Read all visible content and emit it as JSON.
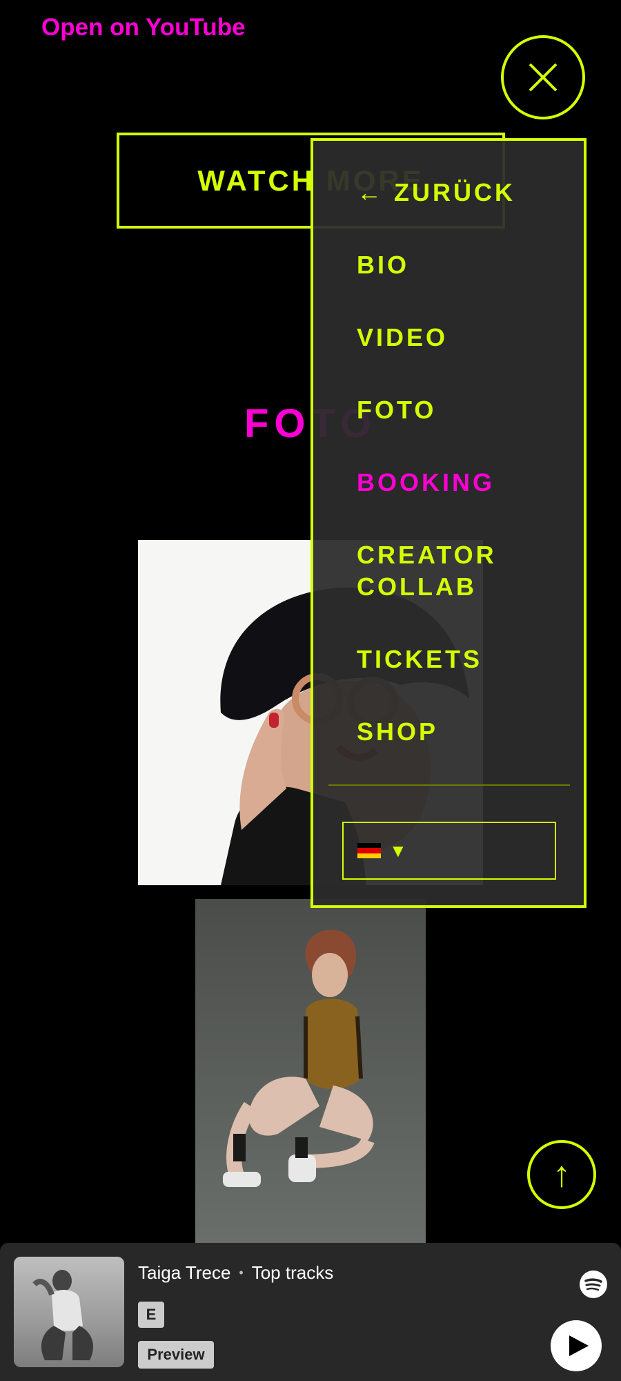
{
  "top": {
    "youtube_link": "Open on YouTube"
  },
  "watch_button": {
    "label": "WATCH MORE"
  },
  "section": {
    "title": "FOTO"
  },
  "menu": {
    "items": [
      {
        "label": "← ZURÜCK",
        "active": false
      },
      {
        "label": "BIO",
        "active": false
      },
      {
        "label": "VIDEO",
        "active": false
      },
      {
        "label": "FOTO",
        "active": false
      },
      {
        "label": "BOOKING",
        "active": true
      },
      {
        "label": "CREATOR\nCOLLAB",
        "active": false
      },
      {
        "label": "TICKETS",
        "active": false
      },
      {
        "label": "SHOP",
        "active": false
      }
    ],
    "language": {
      "selected_flag": "germany-flag-icon",
      "dropdown_icon": "caret-down-icon"
    }
  },
  "player": {
    "artist": "Taiga Trece",
    "separator": "•",
    "playlist": "Top tracks",
    "explicit_badge": "E",
    "preview_badge": "Preview",
    "icons": {
      "brand": "spotify-icon",
      "play": "play-icon"
    }
  },
  "colors": {
    "accent_lime": "#d4ff00",
    "accent_magenta": "#ff00d4",
    "menu_bg": "#2c2c2c",
    "player_bg": "#282828"
  }
}
